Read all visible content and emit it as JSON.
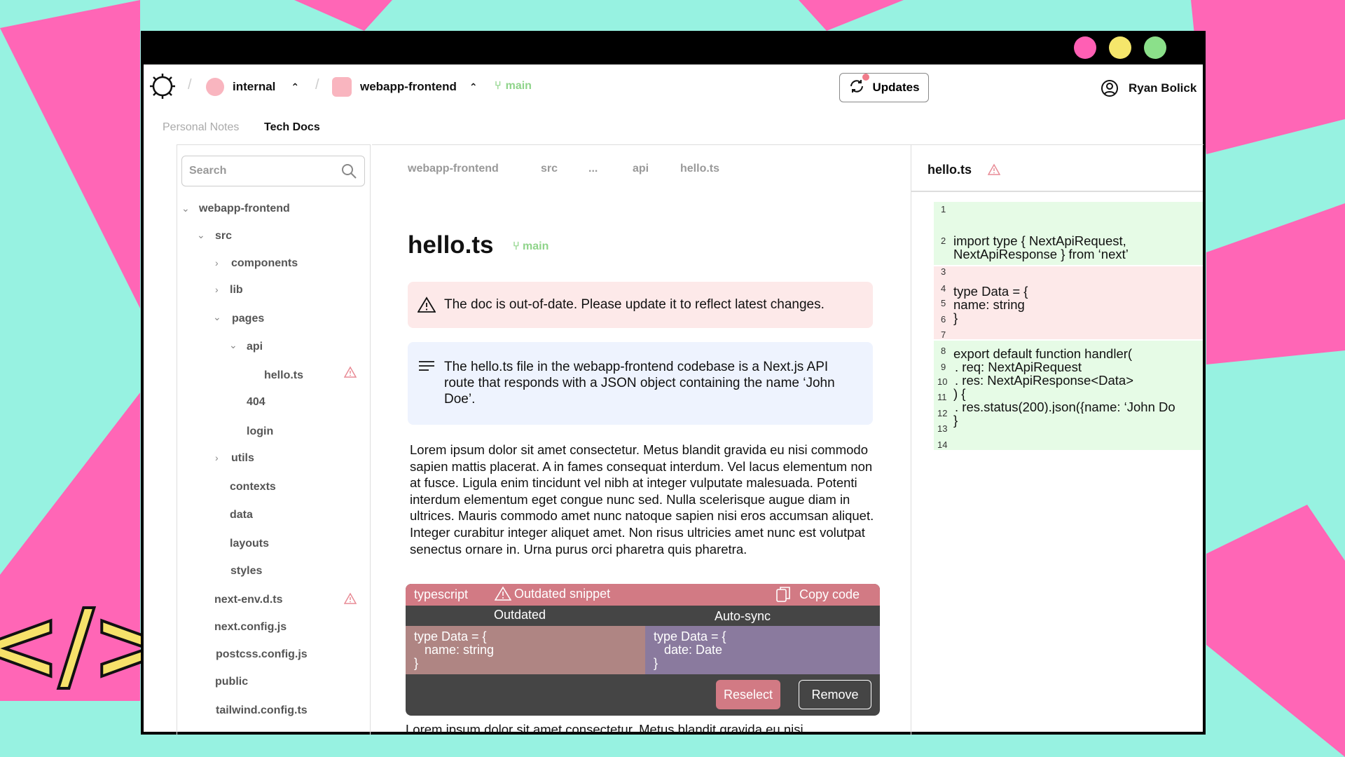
{
  "window": {
    "dots": [
      "#ff5fb4",
      "#f5e66b",
      "#8be08a"
    ]
  },
  "header": {
    "org": "internal",
    "repo": "webapp-frontend",
    "branch": "main",
    "updates_label": "Updates",
    "user": "Ryan Bolick"
  },
  "tabs": [
    "Personal Notes",
    "Tech Docs"
  ],
  "sidebar": {
    "search_placeholder": "Search",
    "tree": [
      {
        "label": "webapp-frontend"
      },
      {
        "label": "src"
      },
      {
        "label": "components"
      },
      {
        "label": "lib"
      },
      {
        "label": "pages"
      },
      {
        "label": "api"
      },
      {
        "label": "hello.ts"
      },
      {
        "label": "404"
      },
      {
        "label": "login"
      },
      {
        "label": "utils"
      },
      {
        "label": "contexts"
      },
      {
        "label": "data"
      },
      {
        "label": "layouts"
      },
      {
        "label": "styles"
      },
      {
        "label": "next-env.d.ts"
      },
      {
        "label": "next.config.js"
      },
      {
        "label": "postcss.config.js"
      },
      {
        "label": "public"
      },
      {
        "label": "tailwind.config.ts"
      }
    ]
  },
  "breadcrumb": [
    "webapp-frontend",
    "src",
    "...",
    "api",
    "hello.ts"
  ],
  "doc": {
    "title": "hello.ts",
    "branch": "main",
    "alert": "The doc is out-of-date. Please update it to reflect latest changes.",
    "summary": "The hello.ts file in the webapp-frontend codebase is a Next.js API route that responds with a JSON object containing the name ‘John Doe’.",
    "body": "Lorem ipsum dolor sit amet consectetur. Metus blandit gravida eu nisi commodo sapien mattis placerat. A in fames consequat interdum. Vel lacus elementum non at fusce. Ligula enim tincidunt vel nibh at integer vulputate malesuada. Potenti interdum elementum eget congue nunc sed. Nulla scelerisque augue diam in ultrices. Mauris commodo amet nunc natoque sapien nisi eros accumsan aliquet. Integer curabitur integer aliquet amet. Non risus ultricies amet nunc est volutpat senectus ornare in. Urna purus orci pharetra quis pharetra.",
    "body_tail": "Lorem ipsum dolor sit amet consectetur. Metus blandit gravida eu nisi",
    "snippet": {
      "language": "typescript",
      "status": "Outdated snippet",
      "copy_label": "Copy code",
      "left_heading": "Outdated",
      "right_heading": "Auto-sync",
      "left_code": "type Data = {\n   name: string\n}",
      "right_code": "type Data = {\n   date: Date\n}",
      "reselect_label": "Reselect",
      "remove_label": "Remove"
    }
  },
  "file_panel": {
    "title": "hello.ts",
    "line_numbers": [
      "1",
      "2",
      "3",
      "4",
      "5",
      "6",
      "7",
      "8",
      "9",
      "10",
      "11",
      "12",
      "13",
      "14"
    ],
    "code": [
      "import type { NextApiRequest,",
      "NextApiResponse } from ‘next’",
      "type Data = {",
      "   name: string",
      "}",
      "export default function handler(",
      ".    req: NextApiRequest",
      ".    res: NextApiResponse<Data>",
      ") {",
      ".        res.status(200).json({name: ‘John Do",
      "}"
    ],
    "colors": {
      "added": "#e6fbe6",
      "removed": "#fde9e9"
    }
  }
}
